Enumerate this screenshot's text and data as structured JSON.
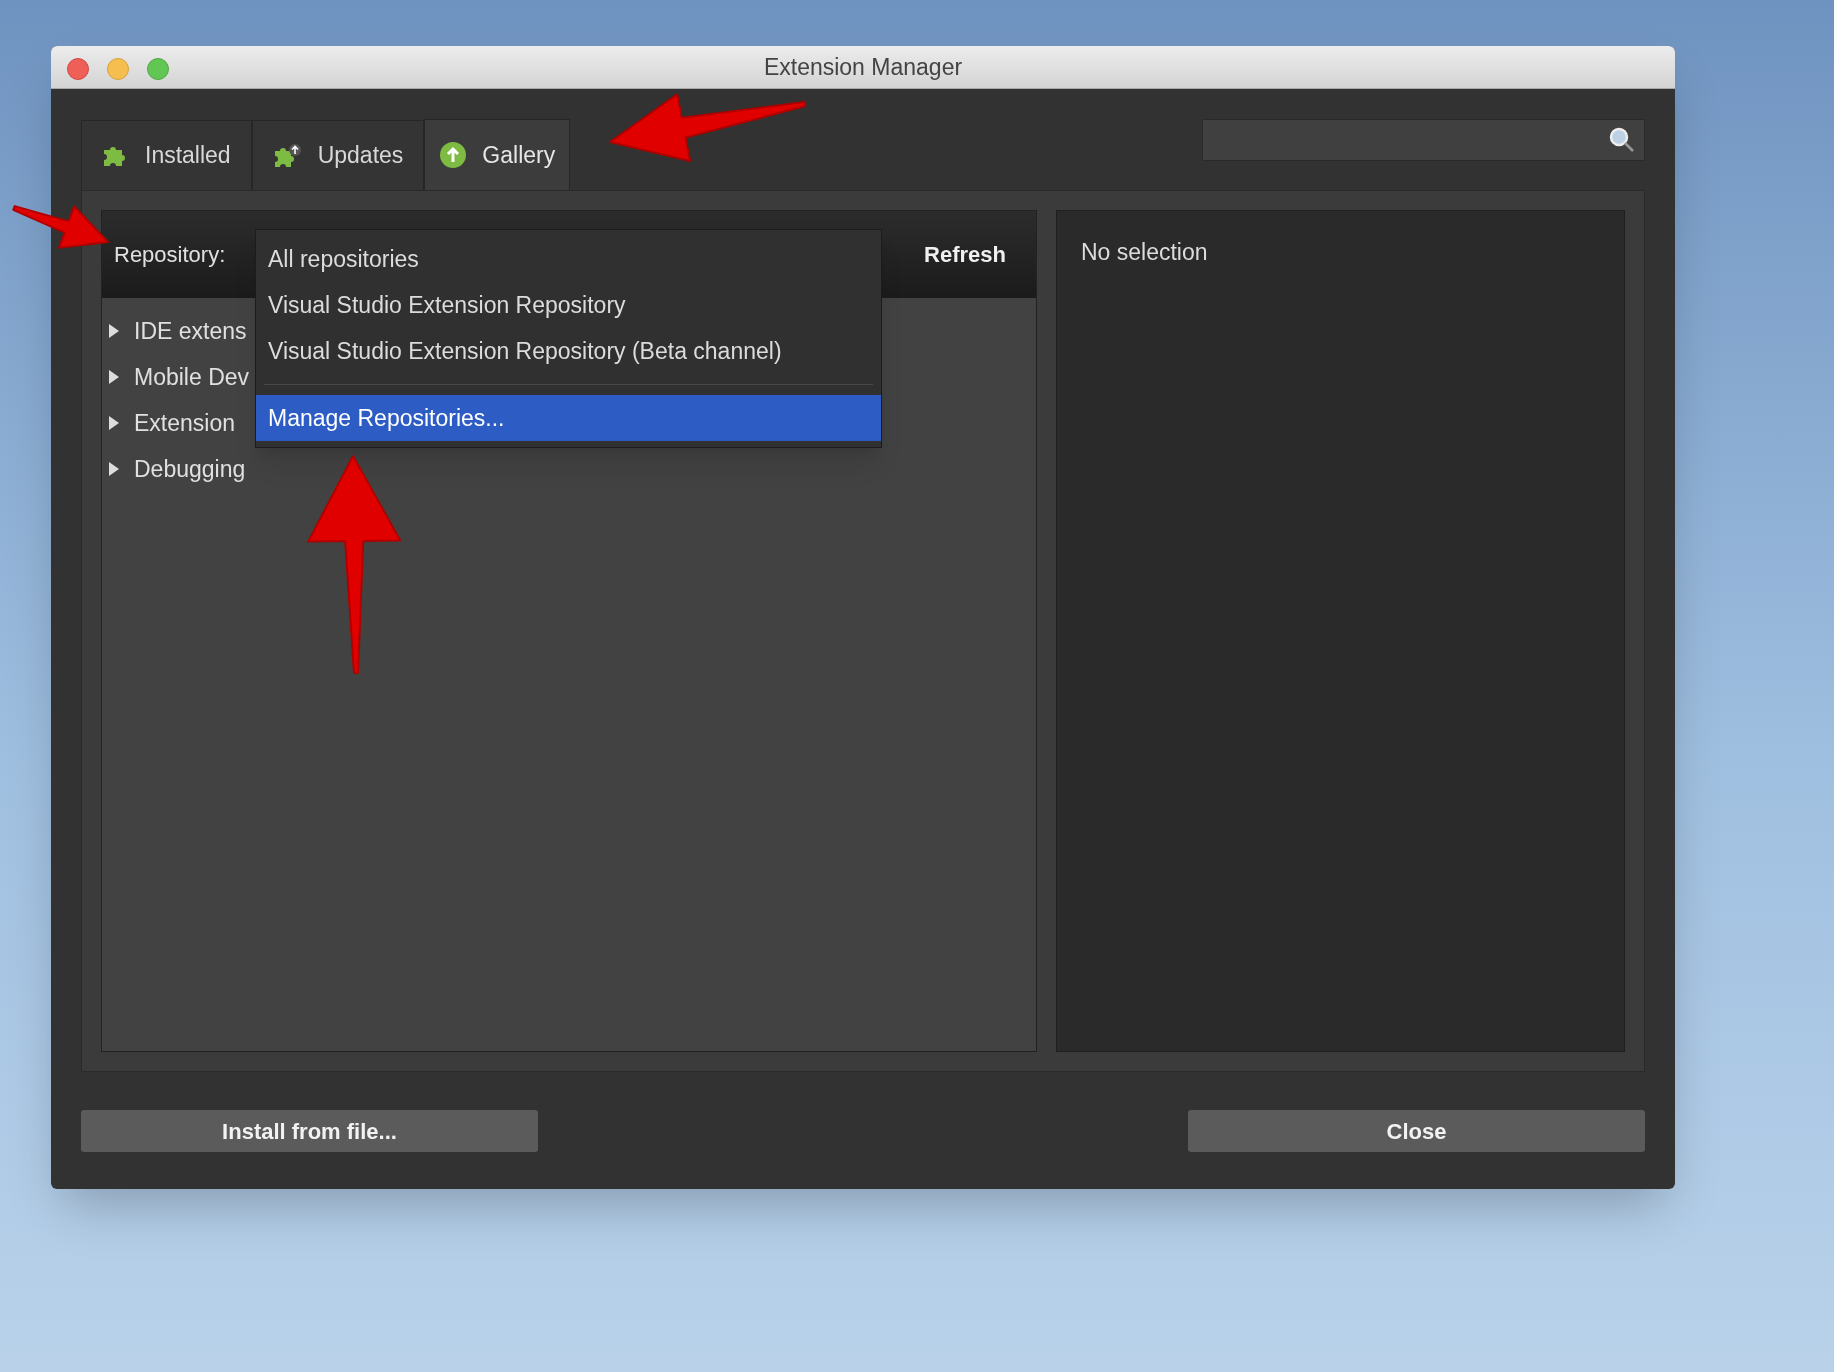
{
  "window": {
    "title": "Extension Manager"
  },
  "tabs": [
    {
      "label": "Installed",
      "kind": "installed",
      "selected": false
    },
    {
      "label": "Updates",
      "kind": "updates",
      "selected": false
    },
    {
      "label": "Gallery",
      "kind": "gallery",
      "selected": true
    }
  ],
  "repository_bar": {
    "label": "Repository:",
    "refresh_button": "Refresh"
  },
  "repository_menu": [
    {
      "label": "All repositories",
      "selected": false
    },
    {
      "label": "Visual Studio Extension Repository",
      "selected": false
    },
    {
      "label": "Visual Studio Extension Repository (Beta channel)",
      "selected": false
    },
    {
      "label": "Manage Repositories...",
      "selected": true,
      "separator_before": true
    }
  ],
  "tree": [
    {
      "label": "IDE extens",
      "expanded": false
    },
    {
      "label": "Mobile Dev",
      "expanded": false
    },
    {
      "label": "Extension",
      "expanded": false
    },
    {
      "label": "Debugging",
      "expanded": false
    }
  ],
  "details": {
    "text": "No selection"
  },
  "buttons": [
    {
      "label": "Install from file..."
    },
    {
      "label": "Close"
    }
  ]
}
